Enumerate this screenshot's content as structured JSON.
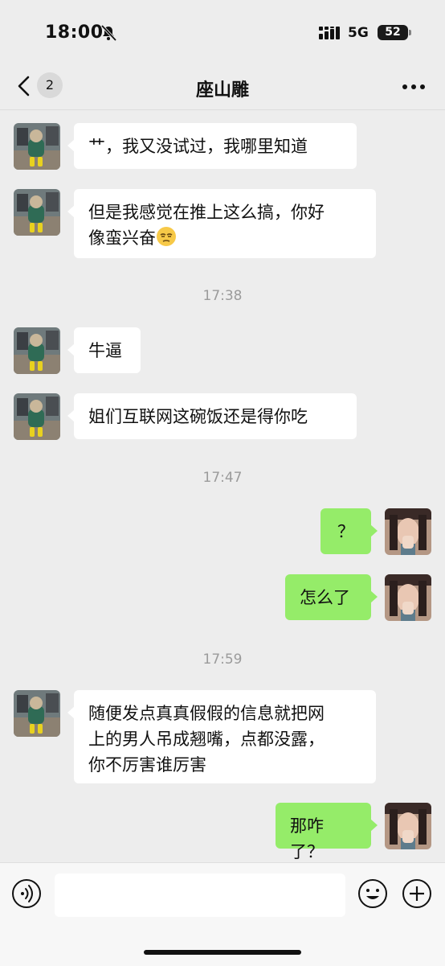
{
  "status_bar": {
    "time": "18:00",
    "network": "5G",
    "battery": "52"
  },
  "header": {
    "unread_count": "2",
    "title": "座山雕"
  },
  "messages": [
    {
      "text": "艹，我又没试过，我哪里知道"
    },
    {
      "text": "但是我感觉在推上这么搞，你好\n像蛮兴奋",
      "emoji": "sleepy-face"
    },
    {
      "timestamp": "17:38"
    },
    {
      "text": "牛逼"
    },
    {
      "text": "姐们互联网这碗饭还是得你吃"
    },
    {
      "timestamp": "17:47"
    },
    {
      "text": "？"
    },
    {
      "text": "怎么了"
    },
    {
      "timestamp": "17:59"
    },
    {
      "text": "随便发点真真假假的信息就把网\n上的男人吊成翘嘴，点都没露，\n你不厉害谁厉害"
    },
    {
      "text": "那咋了？"
    }
  ],
  "input": {
    "value": "",
    "placeholder": ""
  },
  "colors": {
    "outgoing_bubble": "#95ec69",
    "incoming_bubble": "#ffffff",
    "background": "#ededed"
  },
  "icons": [
    "bell-muted-icon",
    "signal-icon",
    "back-chevron-icon",
    "more-icon",
    "voice-icon",
    "emoji-icon",
    "plus-icon"
  ]
}
